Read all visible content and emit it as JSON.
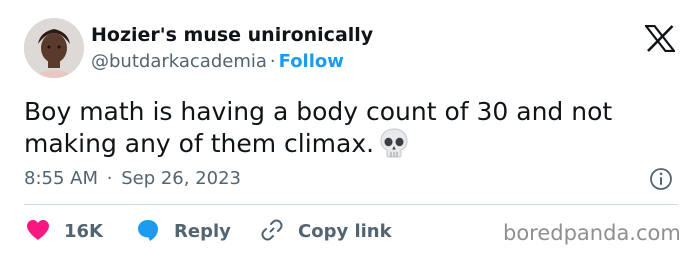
{
  "author": {
    "display_name": "Hozier's muse unironically",
    "handle": "@butdarkacademia",
    "separator": "·",
    "follow_label": "Follow"
  },
  "tweet": {
    "text": "Boy math is having a body count of 30 and not making any of them climax.",
    "emoji_icon": "skull-icon",
    "time": "8:55 AM",
    "separator": "·",
    "date": "Sep 26, 2023"
  },
  "actions": {
    "likes": {
      "icon": "heart-icon",
      "count": "16K",
      "color": "#f91880"
    },
    "reply": {
      "icon": "speech-bubble-icon",
      "label": "Reply",
      "color": "#1d9bf0"
    },
    "copy": {
      "icon": "link-icon",
      "label": "Copy link"
    }
  },
  "watermark": "boredpanda.com",
  "colors": {
    "text": "#0f1419",
    "secondary": "#536471",
    "accent": "#1d9bf0",
    "like": "#f91880",
    "divider": "#cfd9de"
  }
}
